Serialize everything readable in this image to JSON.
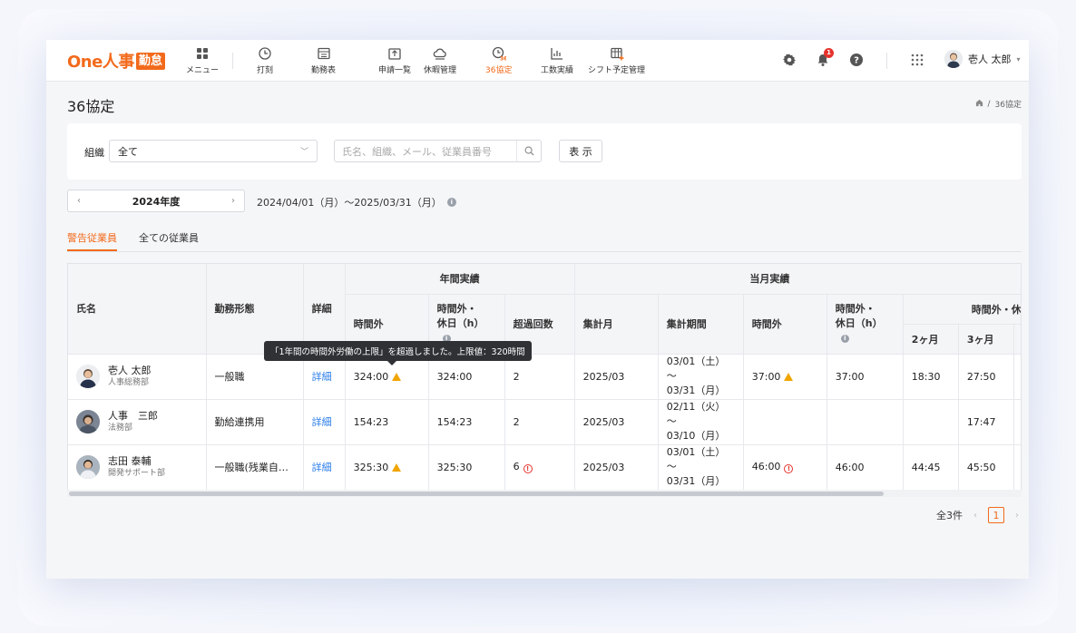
{
  "app": {
    "logo_text": "One人事",
    "logo_badge": "勤怠",
    "accent": "#f26a1b"
  },
  "nav": [
    {
      "label": "メニュー",
      "icon": "grid-menu-icon"
    },
    {
      "label": "打刻",
      "icon": "clock-stamp-icon"
    },
    {
      "label": "勤務表",
      "icon": "timesheet-icon"
    },
    {
      "label": "申請一覧",
      "icon": "request-list-icon"
    },
    {
      "label": "休暇管理",
      "icon": "leave-cloud-icon"
    },
    {
      "label": "36協定",
      "icon": "agreement-36-icon",
      "active": true
    },
    {
      "label": "工数実績",
      "icon": "workload-chart-icon"
    },
    {
      "label": "シフト予定管理",
      "icon": "shift-calendar-icon"
    }
  ],
  "header": {
    "notification_count": "1",
    "user_name": "壱人 太郎"
  },
  "page": {
    "title": "36協定",
    "breadcrumb_current": "36協定",
    "breadcrumb_sep": "/"
  },
  "filter": {
    "org_label": "組織",
    "org_value": "全て",
    "search_placeholder": "氏名、組織、メール、従業員番号",
    "show_button": "表 示"
  },
  "year": {
    "value": "2024年度",
    "prev": "‹",
    "next": "›",
    "period": "2024/04/01（月）～2025/03/31（月）"
  },
  "tabs": [
    {
      "label": "警告従業員",
      "active": true
    },
    {
      "label": "全ての従業員",
      "active": false
    }
  ],
  "table": {
    "headers": {
      "name": "氏名",
      "work_type": "勤務形態",
      "detail": "詳細",
      "annual_group": "年間実績",
      "monthly_group": "当月実績",
      "overtime": "時間外",
      "overtime_holiday_l1": "時間外・",
      "overtime_holiday_l2": "休日（h）",
      "exceed_count": "超過回数",
      "agg_month": "集計月",
      "agg_period": "集計期間",
      "m_overtime": "時間外",
      "m_overtime_holiday_l1": "時間外・",
      "m_overtime_holiday_l2": "休日（h）",
      "avg_group": "時間外・休",
      "two_month": "2ヶ月",
      "three_month": "3ヶ月"
    },
    "rows": [
      {
        "name": "壱人 太郎",
        "dept": "人事総務部",
        "work_type": "一般職",
        "detail": "詳細",
        "overtime": "324:00",
        "overtime_warn": "warn",
        "overtime_holiday": "324:00",
        "exceed": "2",
        "exceed_alert": "",
        "agg_month": "2025/03",
        "period_l1": "03/01（土）～",
        "period_l2": "03/31（月）",
        "m_overtime": "37:00",
        "m_overtime_warn": "warn",
        "m_overtime_holiday": "37:00",
        "two_month": "18:30",
        "three_month": "27:50"
      },
      {
        "name": "人事　三郎",
        "dept": "法務部",
        "work_type": "勤給連携用",
        "detail": "詳細",
        "overtime": "154:23",
        "overtime_warn": "",
        "overtime_holiday": "154:23",
        "exceed": "2",
        "exceed_alert": "",
        "agg_month": "2025/03",
        "period_l1": "02/11（火）～",
        "period_l2": "03/10（月）",
        "m_overtime": "",
        "m_overtime_warn": "",
        "m_overtime_holiday": "",
        "two_month": "",
        "three_month": "17:47"
      },
      {
        "name": "志田 泰輔",
        "dept": "開発サポート部",
        "work_type": "一般職(残業自…",
        "detail": "詳細",
        "overtime": "325:30",
        "overtime_warn": "warn",
        "overtime_holiday": "325:30",
        "exceed": "6",
        "exceed_alert": "alert",
        "agg_month": "2025/03",
        "period_l1": "03/01（土）～",
        "period_l2": "03/31（月）",
        "m_overtime": "46:00",
        "m_overtime_warn": "alert",
        "m_overtime_holiday": "46:00",
        "two_month": "44:45",
        "three_month": "45:50"
      }
    ]
  },
  "tooltip": "「1年間の時間外労働の上限」を超過しました。上限値：320時間",
  "pager": {
    "total": "全3件",
    "current": "1",
    "prev": "‹",
    "next": "›"
  }
}
